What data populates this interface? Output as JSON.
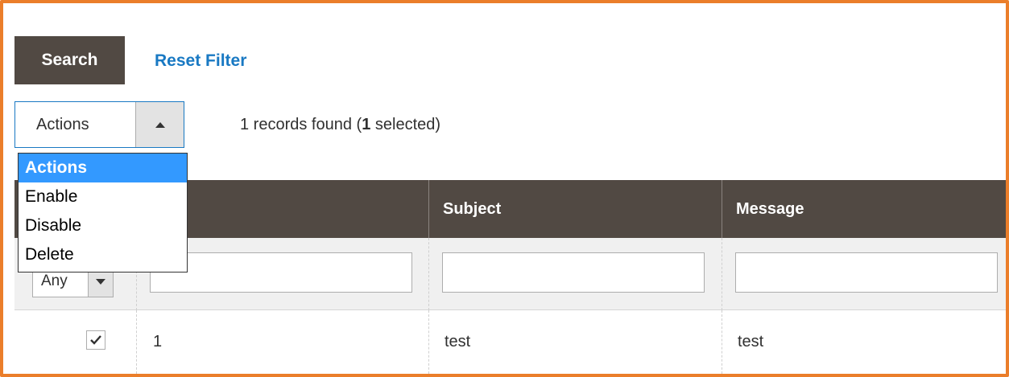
{
  "toolbar": {
    "search_label": "Search",
    "reset_label": "Reset Filter"
  },
  "massactions": {
    "selected_value": "Actions",
    "options": [
      "Actions",
      "Enable",
      "Disable",
      "Delete"
    ],
    "highlighted_index": 0
  },
  "records": {
    "count": "1",
    "text_before": " records found (",
    "selected_count": "1",
    "text_after": " selected)"
  },
  "table": {
    "columns": [
      "",
      "",
      "Subject",
      "Message"
    ],
    "filters": {
      "massaction_select": "Any",
      "id": "",
      "subject": "",
      "message": ""
    },
    "rows": [
      {
        "checked": true,
        "id": "1",
        "subject": "test",
        "message": "test"
      }
    ]
  },
  "colors": {
    "frame": "#eb7e2a",
    "header_bg": "#514943",
    "link": "#1979c3",
    "dropdown_highlight": "#3399ff"
  }
}
